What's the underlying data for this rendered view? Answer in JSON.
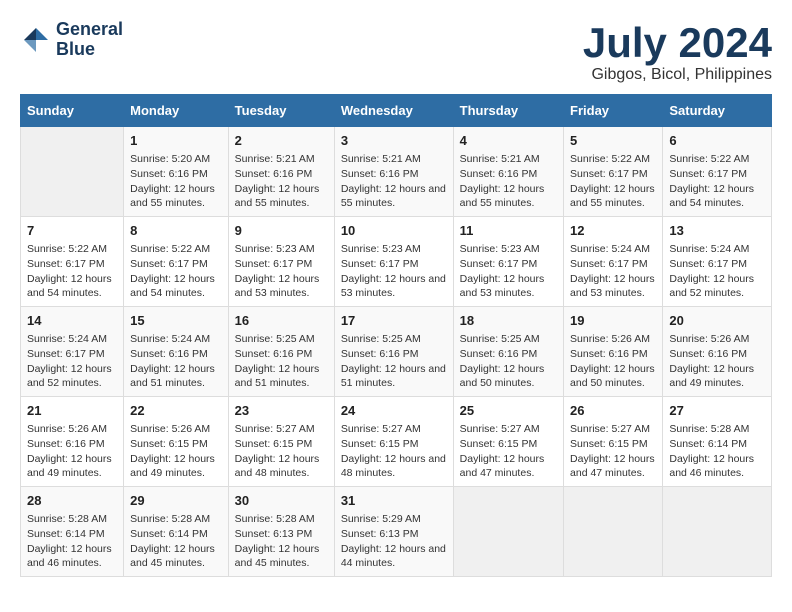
{
  "logo": {
    "line1": "General",
    "line2": "Blue"
  },
  "title": "July 2024",
  "subtitle": "Gibgos, Bicol, Philippines",
  "days_header": [
    "Sunday",
    "Monday",
    "Tuesday",
    "Wednesday",
    "Thursday",
    "Friday",
    "Saturday"
  ],
  "weeks": [
    [
      {
        "day": "",
        "sunrise": "",
        "sunset": "",
        "daylight": ""
      },
      {
        "day": "1",
        "sunrise": "Sunrise: 5:20 AM",
        "sunset": "Sunset: 6:16 PM",
        "daylight": "Daylight: 12 hours and 55 minutes."
      },
      {
        "day": "2",
        "sunrise": "Sunrise: 5:21 AM",
        "sunset": "Sunset: 6:16 PM",
        "daylight": "Daylight: 12 hours and 55 minutes."
      },
      {
        "day": "3",
        "sunrise": "Sunrise: 5:21 AM",
        "sunset": "Sunset: 6:16 PM",
        "daylight": "Daylight: 12 hours and 55 minutes."
      },
      {
        "day": "4",
        "sunrise": "Sunrise: 5:21 AM",
        "sunset": "Sunset: 6:16 PM",
        "daylight": "Daylight: 12 hours and 55 minutes."
      },
      {
        "day": "5",
        "sunrise": "Sunrise: 5:22 AM",
        "sunset": "Sunset: 6:17 PM",
        "daylight": "Daylight: 12 hours and 55 minutes."
      },
      {
        "day": "6",
        "sunrise": "Sunrise: 5:22 AM",
        "sunset": "Sunset: 6:17 PM",
        "daylight": "Daylight: 12 hours and 54 minutes."
      }
    ],
    [
      {
        "day": "7",
        "sunrise": "Sunrise: 5:22 AM",
        "sunset": "Sunset: 6:17 PM",
        "daylight": "Daylight: 12 hours and 54 minutes."
      },
      {
        "day": "8",
        "sunrise": "Sunrise: 5:22 AM",
        "sunset": "Sunset: 6:17 PM",
        "daylight": "Daylight: 12 hours and 54 minutes."
      },
      {
        "day": "9",
        "sunrise": "Sunrise: 5:23 AM",
        "sunset": "Sunset: 6:17 PM",
        "daylight": "Daylight: 12 hours and 53 minutes."
      },
      {
        "day": "10",
        "sunrise": "Sunrise: 5:23 AM",
        "sunset": "Sunset: 6:17 PM",
        "daylight": "Daylight: 12 hours and 53 minutes."
      },
      {
        "day": "11",
        "sunrise": "Sunrise: 5:23 AM",
        "sunset": "Sunset: 6:17 PM",
        "daylight": "Daylight: 12 hours and 53 minutes."
      },
      {
        "day": "12",
        "sunrise": "Sunrise: 5:24 AM",
        "sunset": "Sunset: 6:17 PM",
        "daylight": "Daylight: 12 hours and 53 minutes."
      },
      {
        "day": "13",
        "sunrise": "Sunrise: 5:24 AM",
        "sunset": "Sunset: 6:17 PM",
        "daylight": "Daylight: 12 hours and 52 minutes."
      }
    ],
    [
      {
        "day": "14",
        "sunrise": "Sunrise: 5:24 AM",
        "sunset": "Sunset: 6:17 PM",
        "daylight": "Daylight: 12 hours and 52 minutes."
      },
      {
        "day": "15",
        "sunrise": "Sunrise: 5:24 AM",
        "sunset": "Sunset: 6:16 PM",
        "daylight": "Daylight: 12 hours and 51 minutes."
      },
      {
        "day": "16",
        "sunrise": "Sunrise: 5:25 AM",
        "sunset": "Sunset: 6:16 PM",
        "daylight": "Daylight: 12 hours and 51 minutes."
      },
      {
        "day": "17",
        "sunrise": "Sunrise: 5:25 AM",
        "sunset": "Sunset: 6:16 PM",
        "daylight": "Daylight: 12 hours and 51 minutes."
      },
      {
        "day": "18",
        "sunrise": "Sunrise: 5:25 AM",
        "sunset": "Sunset: 6:16 PM",
        "daylight": "Daylight: 12 hours and 50 minutes."
      },
      {
        "day": "19",
        "sunrise": "Sunrise: 5:26 AM",
        "sunset": "Sunset: 6:16 PM",
        "daylight": "Daylight: 12 hours and 50 minutes."
      },
      {
        "day": "20",
        "sunrise": "Sunrise: 5:26 AM",
        "sunset": "Sunset: 6:16 PM",
        "daylight": "Daylight: 12 hours and 49 minutes."
      }
    ],
    [
      {
        "day": "21",
        "sunrise": "Sunrise: 5:26 AM",
        "sunset": "Sunset: 6:16 PM",
        "daylight": "Daylight: 12 hours and 49 minutes."
      },
      {
        "day": "22",
        "sunrise": "Sunrise: 5:26 AM",
        "sunset": "Sunset: 6:15 PM",
        "daylight": "Daylight: 12 hours and 49 minutes."
      },
      {
        "day": "23",
        "sunrise": "Sunrise: 5:27 AM",
        "sunset": "Sunset: 6:15 PM",
        "daylight": "Daylight: 12 hours and 48 minutes."
      },
      {
        "day": "24",
        "sunrise": "Sunrise: 5:27 AM",
        "sunset": "Sunset: 6:15 PM",
        "daylight": "Daylight: 12 hours and 48 minutes."
      },
      {
        "day": "25",
        "sunrise": "Sunrise: 5:27 AM",
        "sunset": "Sunset: 6:15 PM",
        "daylight": "Daylight: 12 hours and 47 minutes."
      },
      {
        "day": "26",
        "sunrise": "Sunrise: 5:27 AM",
        "sunset": "Sunset: 6:15 PM",
        "daylight": "Daylight: 12 hours and 47 minutes."
      },
      {
        "day": "27",
        "sunrise": "Sunrise: 5:28 AM",
        "sunset": "Sunset: 6:14 PM",
        "daylight": "Daylight: 12 hours and 46 minutes."
      }
    ],
    [
      {
        "day": "28",
        "sunrise": "Sunrise: 5:28 AM",
        "sunset": "Sunset: 6:14 PM",
        "daylight": "Daylight: 12 hours and 46 minutes."
      },
      {
        "day": "29",
        "sunrise": "Sunrise: 5:28 AM",
        "sunset": "Sunset: 6:14 PM",
        "daylight": "Daylight: 12 hours and 45 minutes."
      },
      {
        "day": "30",
        "sunrise": "Sunrise: 5:28 AM",
        "sunset": "Sunset: 6:13 PM",
        "daylight": "Daylight: 12 hours and 45 minutes."
      },
      {
        "day": "31",
        "sunrise": "Sunrise: 5:29 AM",
        "sunset": "Sunset: 6:13 PM",
        "daylight": "Daylight: 12 hours and 44 minutes."
      },
      {
        "day": "",
        "sunrise": "",
        "sunset": "",
        "daylight": ""
      },
      {
        "day": "",
        "sunrise": "",
        "sunset": "",
        "daylight": ""
      },
      {
        "day": "",
        "sunrise": "",
        "sunset": "",
        "daylight": ""
      }
    ]
  ]
}
